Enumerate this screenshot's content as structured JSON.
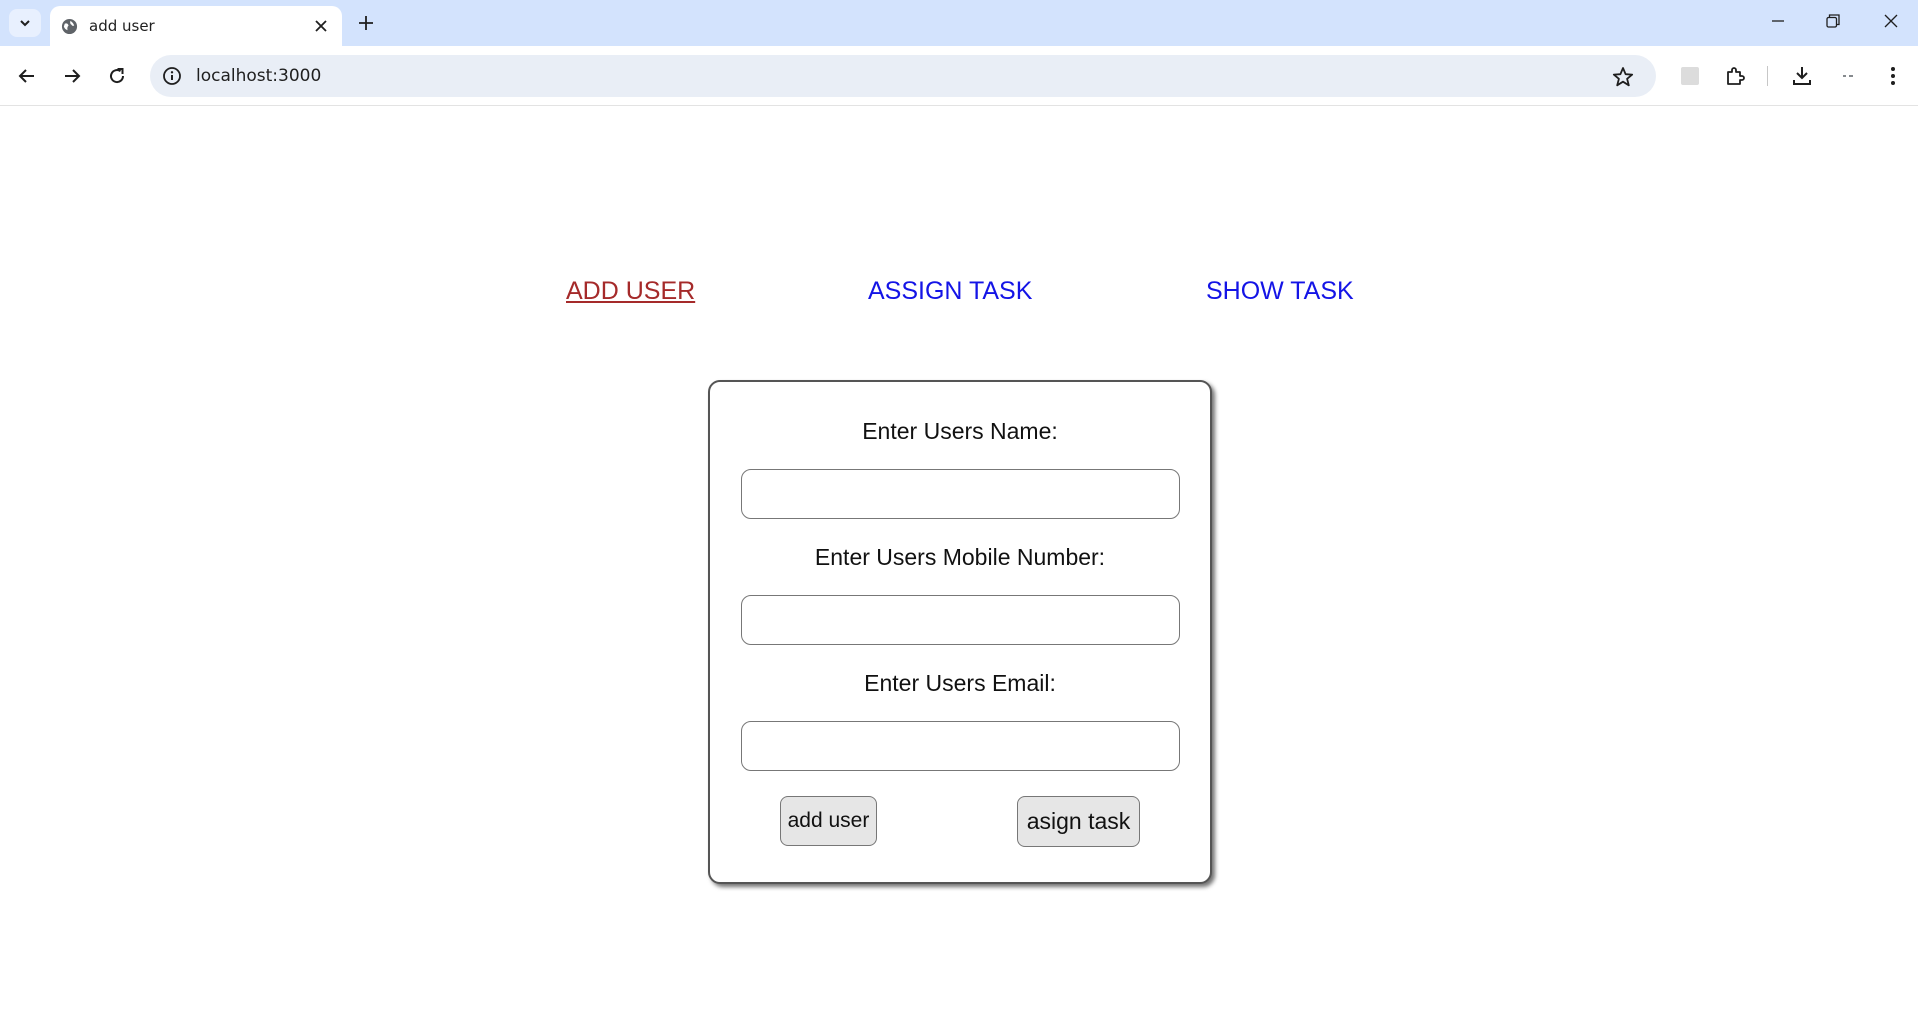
{
  "browser": {
    "tab_title": "add user",
    "url": "localhost:3000"
  },
  "nav": {
    "links": [
      {
        "label": "ADD USER",
        "active": true
      },
      {
        "label": "ASSIGN TASK",
        "active": false
      },
      {
        "label": "SHOW TASK",
        "active": false
      }
    ]
  },
  "form": {
    "name_label": "Enter Users Name:",
    "mobile_label": "Enter Users Mobile Number:",
    "email_label": "Enter Users Email:",
    "name_value": "",
    "mobile_value": "",
    "email_value": "",
    "add_user_label": "add user",
    "assign_task_label": "asign task"
  },
  "colors": {
    "active_link": "#a52a2a",
    "inactive_link": "#1414e6",
    "tabstrip": "#d3e3fd"
  },
  "icons": [
    "tab-search-icon",
    "globe-icon",
    "close-icon",
    "plus-icon",
    "minimize-icon",
    "restore-icon",
    "window-close-icon",
    "back-icon",
    "forward-icon",
    "reload-icon",
    "info-icon",
    "star-icon",
    "extension-puzzle-icon",
    "download-icon",
    "profile-icon",
    "more-vert-icon"
  ]
}
